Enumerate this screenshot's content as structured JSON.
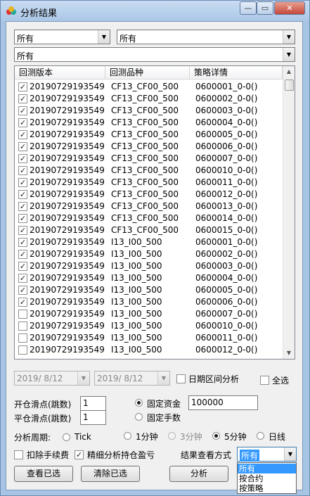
{
  "window": {
    "title": "分析结果",
    "minimize": "—",
    "maximize": "▭",
    "close": "✕"
  },
  "filters": {
    "combo1": "所有",
    "combo2": "所有",
    "combo3": "所有"
  },
  "table": {
    "columns": [
      "回测版本",
      "回测品种",
      "策略详情"
    ],
    "rows": [
      {
        "checked": true,
        "version": "20190729193549",
        "symbol": "CF13_CF00_500",
        "detail": "0600001_0-0()"
      },
      {
        "checked": true,
        "version": "20190729193549",
        "symbol": "CF13_CF00_500",
        "detail": "0600002_0-0()"
      },
      {
        "checked": true,
        "version": "20190729193549",
        "symbol": "CF13_CF00_500",
        "detail": "0600003_0-0()"
      },
      {
        "checked": true,
        "version": "20190729193549",
        "symbol": "CF13_CF00_500",
        "detail": "0600004_0-0()"
      },
      {
        "checked": true,
        "version": "20190729193549",
        "symbol": "CF13_CF00_500",
        "detail": "0600005_0-0()"
      },
      {
        "checked": true,
        "version": "20190729193549",
        "symbol": "CF13_CF00_500",
        "detail": "0600006_0-0()"
      },
      {
        "checked": true,
        "version": "20190729193549",
        "symbol": "CF13_CF00_500",
        "detail": "0600007_0-0()"
      },
      {
        "checked": true,
        "version": "20190729193549",
        "symbol": "CF13_CF00_500",
        "detail": "0600010_0-0()"
      },
      {
        "checked": true,
        "version": "20190729193549",
        "symbol": "CF13_CF00_500",
        "detail": "0600011_0-0()"
      },
      {
        "checked": true,
        "version": "20190729193549",
        "symbol": "CF13_CF00_500",
        "detail": "0600012_0-0()"
      },
      {
        "checked": true,
        "version": "20190729193549",
        "symbol": "CF13_CF00_500",
        "detail": "0600013_0-0()"
      },
      {
        "checked": true,
        "version": "20190729193549",
        "symbol": "CF13_CF00_500",
        "detail": "0600014_0-0()"
      },
      {
        "checked": true,
        "version": "20190729193549",
        "symbol": "CF13_CF00_500",
        "detail": "0600015_0-0()"
      },
      {
        "checked": true,
        "version": "20190729193549",
        "symbol": "I13_I00_500",
        "detail": "0600001_0-0()"
      },
      {
        "checked": true,
        "version": "20190729193549",
        "symbol": "I13_I00_500",
        "detail": "0600002_0-0()"
      },
      {
        "checked": true,
        "version": "20190729193549",
        "symbol": "I13_I00_500",
        "detail": "0600003_0-0()"
      },
      {
        "checked": true,
        "version": "20190729193549",
        "symbol": "I13_I00_500",
        "detail": "0600004_0-0()"
      },
      {
        "checked": true,
        "version": "20190729193549",
        "symbol": "I13_I00_500",
        "detail": "0600005_0-0()"
      },
      {
        "checked": true,
        "version": "20190729193549",
        "symbol": "I13_I00_500",
        "detail": "0600006_0-0()"
      },
      {
        "checked": false,
        "version": "20190729193549",
        "symbol": "I13_I00_500",
        "detail": "0600007_0-0()"
      },
      {
        "checked": false,
        "version": "20190729193549",
        "symbol": "I13_I00_500",
        "detail": "0600010_0-0()"
      },
      {
        "checked": false,
        "version": "20190729193549",
        "symbol": "I13_I00_500",
        "detail": "0600011_0-0()"
      },
      {
        "checked": false,
        "version": "20190729193549",
        "symbol": "I13_I00_500",
        "detail": "0600012_0-0()"
      }
    ]
  },
  "dates": {
    "start": "2019/  8/12",
    "end": "2019/  8/12",
    "range_label": "日期区间分析",
    "select_all_label": "全选"
  },
  "settings": {
    "open_slip_label": "开仓滑点(跳数)",
    "open_slip_value": "1",
    "close_slip_label": "平仓滑点(跳数)",
    "close_slip_value": "1",
    "fixed_capital_label": "固定资金",
    "fixed_capital_value": "100000",
    "fixed_lots_label": "固定手数"
  },
  "period": {
    "label": "分析周期:",
    "options": [
      "Tick",
      "1分钟",
      "3分钟",
      "5分钟",
      "日线"
    ],
    "selected": "5分钟"
  },
  "options": {
    "deduct_fee_label": "扣除手续费",
    "deduct_fee_checked": false,
    "detail_label": "精细分析持仓盈亏",
    "detail_checked": true
  },
  "result_view": {
    "label": "结果查看方式",
    "value": "所有",
    "dropdown": [
      "所有",
      "按合约",
      "按策略"
    ],
    "highlighted": "所有"
  },
  "buttons": {
    "view_selected": "查看已选",
    "clear_selected": "清除已选",
    "analyze": "分析"
  }
}
